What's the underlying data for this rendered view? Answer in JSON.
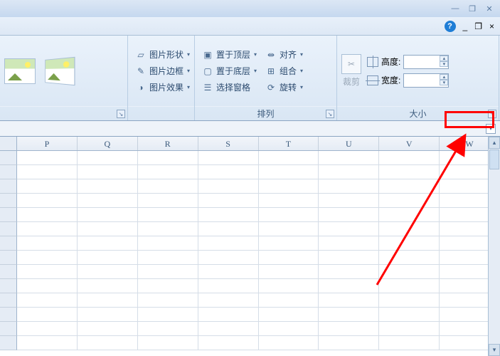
{
  "ribbon": {
    "group2": {
      "shape": "图片形状",
      "border": "图片边框",
      "effects": "图片效果"
    },
    "group3": {
      "label": "排列",
      "bringFront": "置于顶层",
      "sendBack": "置于底层",
      "selectionPane": "选择窗格",
      "align": "对齐",
      "group": "组合",
      "rotate": "旋转"
    },
    "group4": {
      "label": "大小",
      "crop": "裁剪",
      "height": "高度:",
      "width": "宽度:",
      "heightVal": "",
      "widthVal": ""
    }
  },
  "columns": [
    "P",
    "Q",
    "R",
    "S",
    "T",
    "U",
    "V",
    "W"
  ]
}
